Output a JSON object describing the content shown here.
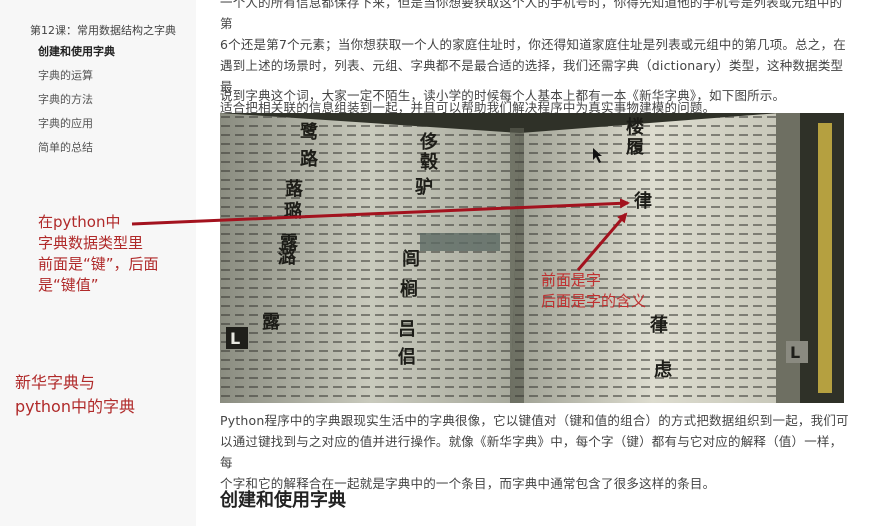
{
  "sidebar": {
    "lesson_title": "第12课：常用数据结构之字典",
    "items": [
      {
        "label": "创建和使用字典",
        "active": true
      },
      {
        "label": "字典的运算",
        "active": false
      },
      {
        "label": "字典的方法",
        "active": false
      },
      {
        "label": "字典的应用",
        "active": false
      },
      {
        "label": "简单的总结",
        "active": false
      }
    ]
  },
  "content": {
    "para1_line1": "一个人的所有信息都保存下来，但是当你想要获取这个人的手机号时，你得先知道他的手机号是列表或元组中的第",
    "para1_line2": "6个还是第7个元素；当你想获取一个人的家庭住址时，你还得知道家庭住址是列表或元组中的第几项。总之，在",
    "para1_line3": "遇到上述的场景时，列表、元组、字典都不是最合适的选择，我们还需字典（dictionary）类型，这种数据类型最",
    "para1_line4": "适合把相关联的信息组装到一起，并且可以帮助我们解决程序中为真实事物建模的问题。",
    "para2": "说到字典这个词，大家一定不陌生，读小学的时候每个人基本上都有一本《新华字典》，如下图所示。",
    "para3_line1": "Python程序中的字典跟现实生活中的字典很像，它以键值对（键和值的组合）的方式把数据组织到一起，我们可",
    "para3_line2": "以通过键找到与之对应的值并进行操作。就像《新华字典》中，每个字（键）都有与它对应的解释（值）一样，每",
    "para3_line3": "个字和它的解释合在一起就是字典中的一个条目，而字典中通常包含了很多这样的条目。",
    "heading": "创建和使用字典"
  },
  "book_photo": {
    "left_chars": [
      "鹭",
      "路",
      "蕗",
      "璐",
      "露",
      "潞",
      "鹭",
      "露"
    ],
    "middle_chars": [
      "侈",
      "毂",
      "驴",
      "闾",
      "榈",
      "吕",
      "侣"
    ],
    "right_chars": [
      "楼",
      "履",
      "律",
      "葎",
      "虑"
    ],
    "corner_letter": "L"
  },
  "annotations": {
    "left_note": [
      "在python中",
      "字典数据类型里",
      "前面是“键”，后面",
      "是“键值”"
    ],
    "bottom_note": [
      "新华字典与",
      "python中的字典"
    ],
    "right_note": [
      "前面是字",
      "后面是字的含义"
    ]
  },
  "colors": {
    "annotation": "#b02a2a",
    "arrow": "#a3121e"
  }
}
